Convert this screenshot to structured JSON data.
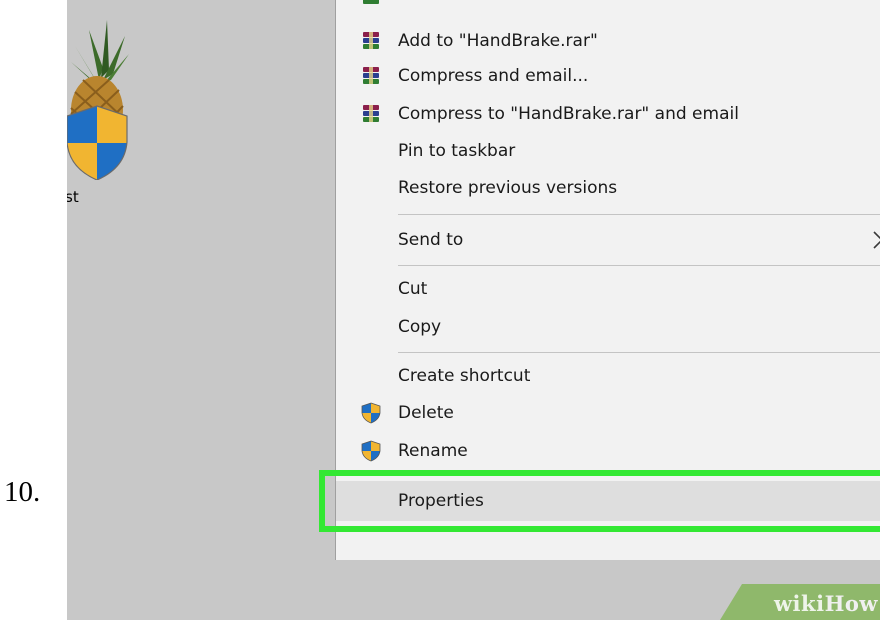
{
  "step": {
    "number": "10."
  },
  "desktop": {
    "icon_name": "pineapple-shield-icon",
    "icon_label": "st"
  },
  "context_menu": {
    "items": [
      {
        "label": "Add to \"HandBrake.rar\"",
        "icon": "winrar-archive-icon"
      },
      {
        "label": "Compress and email...",
        "icon": "winrar-archive-icon"
      },
      {
        "label": "Compress to \"HandBrake.rar\" and email",
        "icon": "winrar-archive-icon"
      },
      {
        "label": "Pin to taskbar",
        "icon": ""
      },
      {
        "label": "Restore previous versions",
        "icon": ""
      },
      {
        "label": "Send to",
        "icon": "",
        "submenu": true
      },
      {
        "label": "Cut",
        "icon": ""
      },
      {
        "label": "Copy",
        "icon": ""
      },
      {
        "label": "Create shortcut",
        "icon": ""
      },
      {
        "label": "Delete",
        "icon": "uac-shield-icon"
      },
      {
        "label": "Rename",
        "icon": "uac-shield-icon"
      },
      {
        "label": "Properties",
        "icon": "",
        "highlighted": true
      }
    ]
  },
  "highlight_color": "#33e833",
  "watermark": {
    "part1": "wiki",
    "part2": "How"
  }
}
